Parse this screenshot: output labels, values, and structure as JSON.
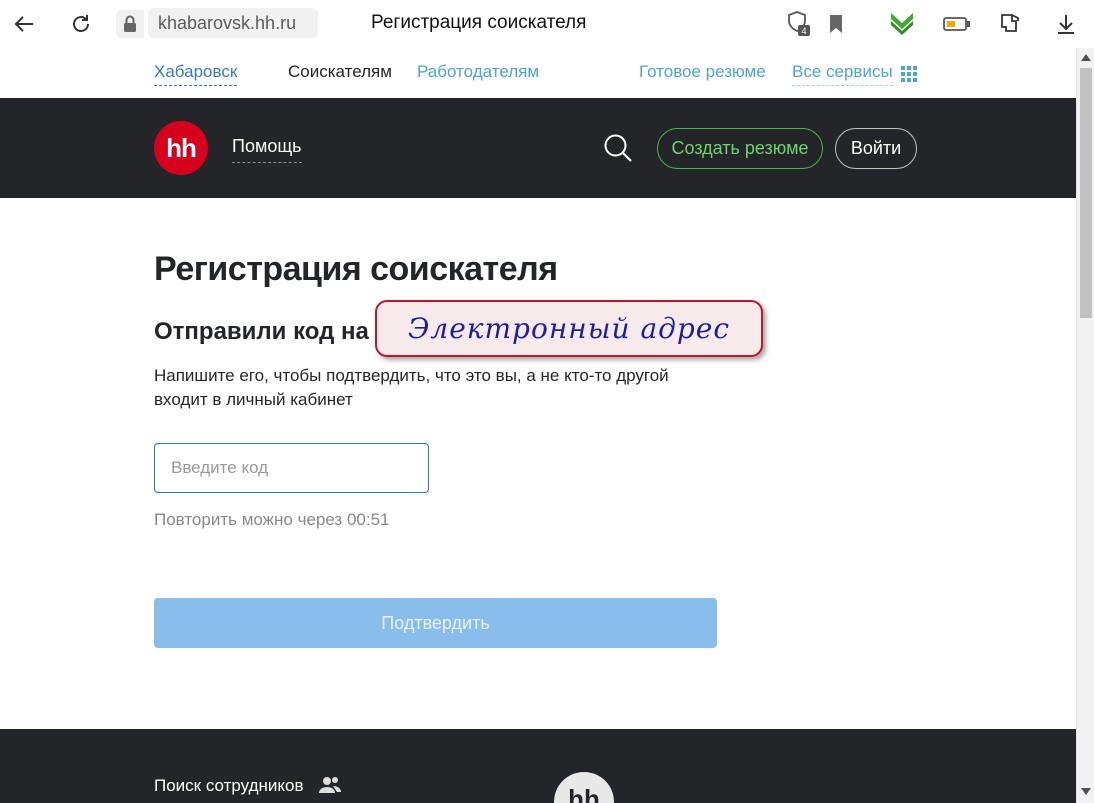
{
  "browser": {
    "url": "khabarovsk.hh.ru",
    "tab_title": "Регистрация соискателя",
    "badge_count": "4"
  },
  "topnav": {
    "city": "Хабаровск",
    "seekers": "Соискателям",
    "employers": "Работодателям",
    "ready_resume": "Готовое резюме",
    "all_services": "Все сервисы"
  },
  "header": {
    "logo": "hh",
    "help": "Помощь",
    "create_resume": "Создать резюме",
    "login": "Войти"
  },
  "main": {
    "title": "Регистрация соискателя",
    "subtitle": "Отправили код на",
    "annotation": "Электронный адрес",
    "description": "Напишите его, чтобы подтвердить, что это вы, а не кто-то другой входит в личный кабинет",
    "code_placeholder": "Введите код",
    "repeat_text": "Повторить можно через 00:51",
    "confirm_button": "Подтвердить"
  },
  "footer": {
    "find_employees": "Поиск сотрудников",
    "logo": "hh"
  },
  "colors": {
    "header_bg": "#232529",
    "brand_red": "#d6001c",
    "link_blue": "#4da3da",
    "confirm_disabled": "#88bdec",
    "create_green": "#4bb24b"
  }
}
